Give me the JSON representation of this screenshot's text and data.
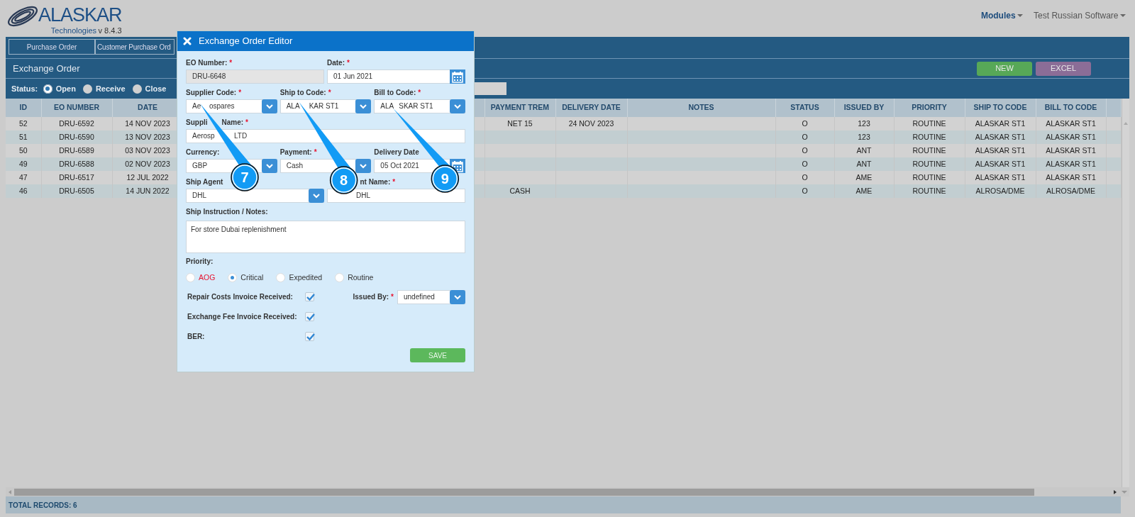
{
  "header": {
    "logo_text": "ALASKAR",
    "logo_subtitle": "Technologies",
    "version": "v 8.4.3",
    "menus": [
      {
        "label": "Modules",
        "emphasized": true
      },
      {
        "label": "Test Russian Software",
        "emphasized": false
      }
    ]
  },
  "tabs": [
    {
      "label": "Purchase Order",
      "selected": false
    },
    {
      "label": "Customer Purchase Ord",
      "selected": false
    }
  ],
  "page_title": "Exchange Order",
  "actions": [
    {
      "label": "NEW",
      "color": "#57a857"
    },
    {
      "label": "EXCEL",
      "color": "#8b6d97"
    }
  ],
  "status_filter": {
    "label": "Status:",
    "options": [
      {
        "label": "Open",
        "selected": true
      },
      {
        "label": "Receive",
        "selected": false
      },
      {
        "label": "Close",
        "selected": false
      }
    ]
  },
  "table": {
    "columns": [
      "ID",
      "EO NUMBER",
      "DATE",
      "PAYMENT TREM",
      "DELIVERY DATE",
      "NOTES",
      "STATUS",
      "ISSUED BY",
      "PRIORITY",
      "SHIP TO CODE",
      "BILL TO CODE"
    ],
    "rows": [
      [
        "52",
        "DRU-6592",
        "14 NOV 2023",
        "NET 15",
        "24 NOV 2023",
        null,
        "O",
        "123",
        "ROUTINE",
        "ALASKAR ST1",
        "ALASKAR ST1"
      ],
      [
        "51",
        "DRU-6590",
        "13 NOV 2023",
        null,
        null,
        null,
        "O",
        "123",
        "ROUTINE",
        "ALASKAR ST1",
        "ALASKAR ST1"
      ],
      [
        "50",
        "DRU-6589",
        "03 NOV 2023",
        null,
        null,
        null,
        "O",
        "ANT",
        "ROUTINE",
        "ALASKAR ST1",
        "ALASKAR ST1"
      ],
      [
        "49",
        "DRU-6588",
        "02 NOV 2023",
        null,
        null,
        null,
        "O",
        "ANT",
        "ROUTINE",
        "ALASKAR ST1",
        "ALASKAR ST1"
      ],
      [
        "47",
        "DRU-6517",
        "12 JUL 2022",
        null,
        null,
        null,
        "O",
        "AME",
        "ROUTINE",
        "ALASKAR ST1",
        "ALASKAR ST1"
      ],
      [
        "46",
        "DRU-6505",
        "14 JUN 2022",
        "CASH",
        null,
        null,
        "O",
        "AME",
        "ROUTINE",
        "ALROSA/DME",
        "ALROSA/DME"
      ]
    ]
  },
  "footer": "TOTAL RECORDS: 6",
  "dialog": {
    "title": "Exchange Order Editor",
    "form_rows": [
      [
        {
          "kind": "text",
          "label": [
            "EO Number:"
          ],
          "required_mark": "*",
          "value": [
            "DRU-6648"
          ],
          "disabled": true
        },
        {
          "kind": "date",
          "label": [
            "Date:"
          ],
          "required_mark": "*",
          "value": [
            "01 Jun 2021"
          ],
          "disabled": false
        }
      ],
      [
        {
          "kind": "select",
          "label": [
            "Supplier Code:"
          ],
          "required_mark": "*",
          "value": [
            "Ae",
            "ospares"
          ],
          "callout": "7",
          "disabled": false
        },
        {
          "kind": "select",
          "label": [
            "Ship to Code:"
          ],
          "required_mark": "*",
          "value": [
            "ALA",
            "KAR ST1"
          ],
          "callout": "8",
          "disabled": false
        },
        {
          "kind": "select",
          "label": [
            "Bill to Code:"
          ],
          "required_mark": "*",
          "value": [
            "ALA",
            "SKAR ST1"
          ],
          "callout": "9",
          "disabled": false
        }
      ],
      [
        {
          "kind": "text",
          "label": [
            "Suppli",
            "Name:"
          ],
          "required_mark": "*",
          "value": [
            "Aerosp",
            "LTD"
          ],
          "disabled": false
        }
      ],
      [
        {
          "kind": "select",
          "label": [
            "Currency:"
          ],
          "value": [
            "GBP"
          ],
          "disabled": false
        },
        {
          "kind": "select",
          "label": [
            "Payment:"
          ],
          "required_mark": "*",
          "value": [
            "Cash"
          ],
          "disabled": false
        },
        {
          "kind": "date",
          "label": [
            "Delivery Date"
          ],
          "value": [
            "05 Oct 2021"
          ],
          "disabled": false
        }
      ],
      [
        {
          "kind": "select",
          "label": [
            "Ship Agent"
          ],
          "value": [
            "DHL"
          ],
          "disabled": false
        },
        {
          "kind": "text",
          "label": [
            "nt Name:"
          ],
          "required_mark": "*",
          "value": [
            "DHL"
          ],
          "disabled": false
        }
      ]
    ],
    "notes": {
      "label": "Ship Instruction / Notes:",
      "value": "For store Dubai replenishment"
    },
    "priority": {
      "label": "Priority:",
      "options": [
        {
          "label": "AOG",
          "color": "#e8112d",
          "selected": false
        },
        {
          "label": "Critical",
          "color": "#333333",
          "selected": true
        },
        {
          "label": "Expedited",
          "color": "#333333",
          "selected": false
        },
        {
          "label": "Routine",
          "color": "#333333",
          "selected": false
        }
      ]
    },
    "checks": [
      {
        "label": "Repair Costs Invoice Received:",
        "checked": true
      },
      {
        "label": "Exchange Fee Invoice Received:",
        "checked": true
      },
      {
        "label": "BER:",
        "checked": true
      }
    ],
    "issued_by": {
      "label": "Issued By:",
      "required_mark": "*",
      "value": "undefined"
    },
    "save": "SAVE"
  }
}
